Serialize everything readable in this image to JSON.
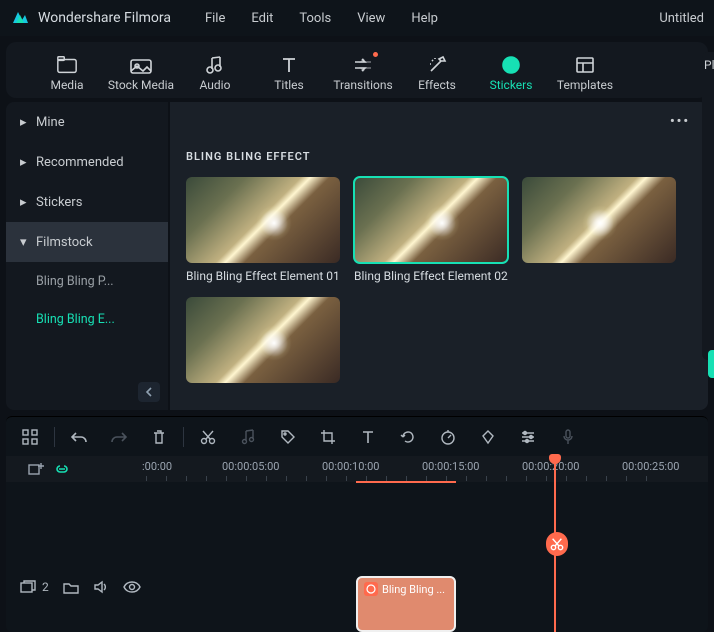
{
  "app": {
    "brand": "Wondershare Filmora",
    "untitled": "Untitled"
  },
  "menu": {
    "file": "File",
    "edit": "Edit",
    "tools": "Tools",
    "view": "View",
    "help": "Help"
  },
  "ribbon": {
    "media": "Media",
    "stockmedia": "Stock Media",
    "audio": "Audio",
    "titles": "Titles",
    "transitions": "Transitions",
    "effects": "Effects",
    "stickers": "Stickers",
    "templates": "Templates",
    "previewLabel": "Pl"
  },
  "sidebar": {
    "mine": "Mine",
    "recommended": "Recommended",
    "stickers": "Stickers",
    "filmstock": "Filmstock",
    "sub1": "Bling Bling P...",
    "sub2": "Bling Bling E..."
  },
  "content": {
    "section": "BLING BLING EFFECT",
    "card1": "Bling Bling Effect Element 01",
    "card2": "Bling Bling Effect Element 02"
  },
  "timeline": {
    "t0": ":00:00",
    "t1": "00:00:05:00",
    "t2": "00:00:10:00",
    "t3": "00:00:15:00",
    "t4": "00:00:20:00",
    "t5": "00:00:25:00",
    "trackcount": "2",
    "clip": "Bling Bling ..."
  }
}
